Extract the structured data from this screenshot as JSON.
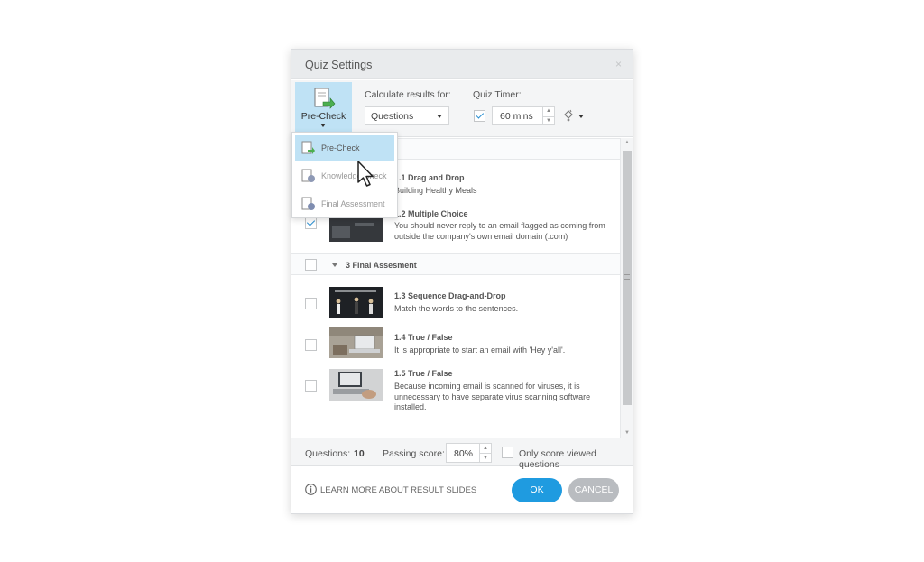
{
  "dialog": {
    "title": "Quiz Settings",
    "close_glyph": "×"
  },
  "toolbar": {
    "quiz_type": {
      "label": "Pre-Check",
      "icon": "precheck-icon"
    },
    "calculate": {
      "label": "Calculate results for:",
      "value": "Questions"
    },
    "timer": {
      "label": "Quiz Timer:",
      "checked": true,
      "value": "60 mins",
      "up": "▲",
      "down": "▼"
    },
    "palette_icon": "paint-bucket-icon"
  },
  "menu": {
    "items": [
      {
        "label": "Pre-Check",
        "selected": true
      },
      {
        "label": "Knowledge Check",
        "selected": false
      },
      {
        "label": "Final Assessment",
        "selected": false
      }
    ]
  },
  "list": {
    "items_top": [
      {
        "title": "1.1  Drag and Drop",
        "desc": "Building Healthy Meals"
      },
      {
        "title": "1.2  Multiple Choice",
        "desc": "You should never reply to an email flagged as coming from outside the company's own email domain (.com)",
        "checked": true
      }
    ],
    "section": {
      "title": "3 Final Assesment"
    },
    "items_bottom": [
      {
        "title": "1.3  Sequence Drag-and-Drop",
        "desc": "Match the words to the sentences."
      },
      {
        "title": "1.4  True / False",
        "desc": "It is appropriate to start an email with 'Hey y'all'."
      },
      {
        "title": "1.5  True / False",
        "desc": "Because incoming email is scanned for viruses, it is unnecessary to have separate virus scanning software installed."
      }
    ]
  },
  "footer": {
    "questions_label": "Questions:",
    "questions_count": "10",
    "passing_label": "Passing score:",
    "passing_value": "80%",
    "only_viewed_label": "Only score viewed questions",
    "learn_more": "LEARN MORE ABOUT RESULT SLIDES",
    "ok": "OK",
    "cancel": "CANCEL"
  },
  "colors": {
    "accent": "#1f9be0",
    "selected_bg": "#bfe2f5",
    "cancel": "#b9bcc0"
  }
}
